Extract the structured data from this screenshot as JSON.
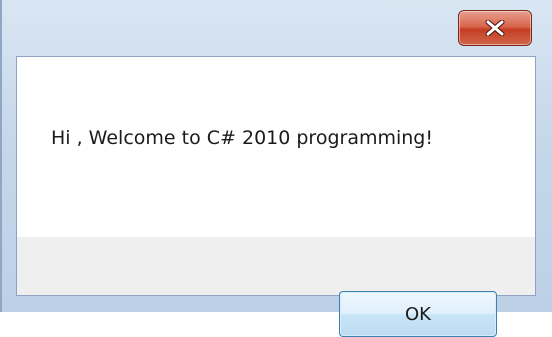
{
  "dialog": {
    "message": "Hi , Welcome to C# 2010 programming!",
    "ok_label": "OK",
    "close_icon": "close-icon"
  },
  "colors": {
    "close_button": "#d9664f",
    "ok_border": "#3c7fb1",
    "button_bar": "#efefef",
    "frame": "#c6d7ea"
  }
}
